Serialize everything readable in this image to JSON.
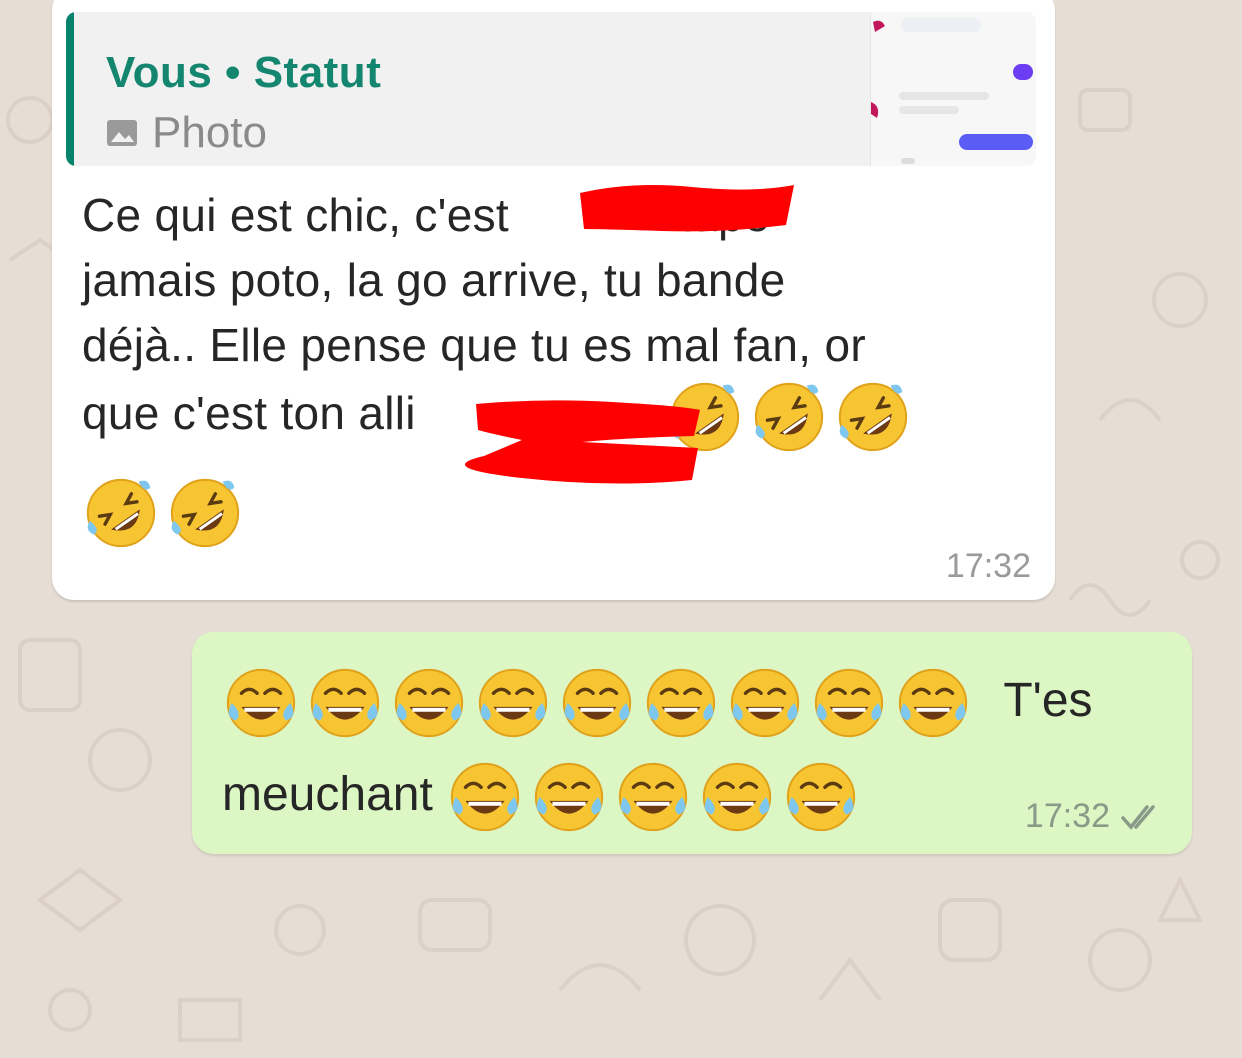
{
  "conversation": {
    "incoming": {
      "quote": {
        "author": "Vous",
        "separator": "•",
        "source": "Statut",
        "type_label": "Photo",
        "type_icon": "photo-icon"
      },
      "line1": "Ce qui est chic, c'est",
      "line1_end": "tape",
      "line2": "jamais poto, la go arrive, tu bande",
      "line3": "déjà.. Elle pense que tu es mal fan, or",
      "line4": "que c'est ton alli",
      "emoji_name": "rolling-on-floor-laughing-emoji",
      "emoji_count_line4": 3,
      "emoji_count_line5": 2,
      "time": "17:32"
    },
    "outgoing": {
      "emoji_name": "face-with-tears-of-joy-emoji",
      "emoji_count_line1": 9,
      "word1": "T'es",
      "word2": "meuchant",
      "emoji_count_line2": 5,
      "time": "17:32",
      "status": "read",
      "status_icon": "double-check-icon"
    }
  },
  "colors": {
    "wallpaper": "#e6ddd4",
    "incoming_bubble": "#ffffff",
    "outgoing_bubble": "#dcf6c4",
    "quote_accent": "#07836c",
    "redaction": "#ff0000"
  }
}
